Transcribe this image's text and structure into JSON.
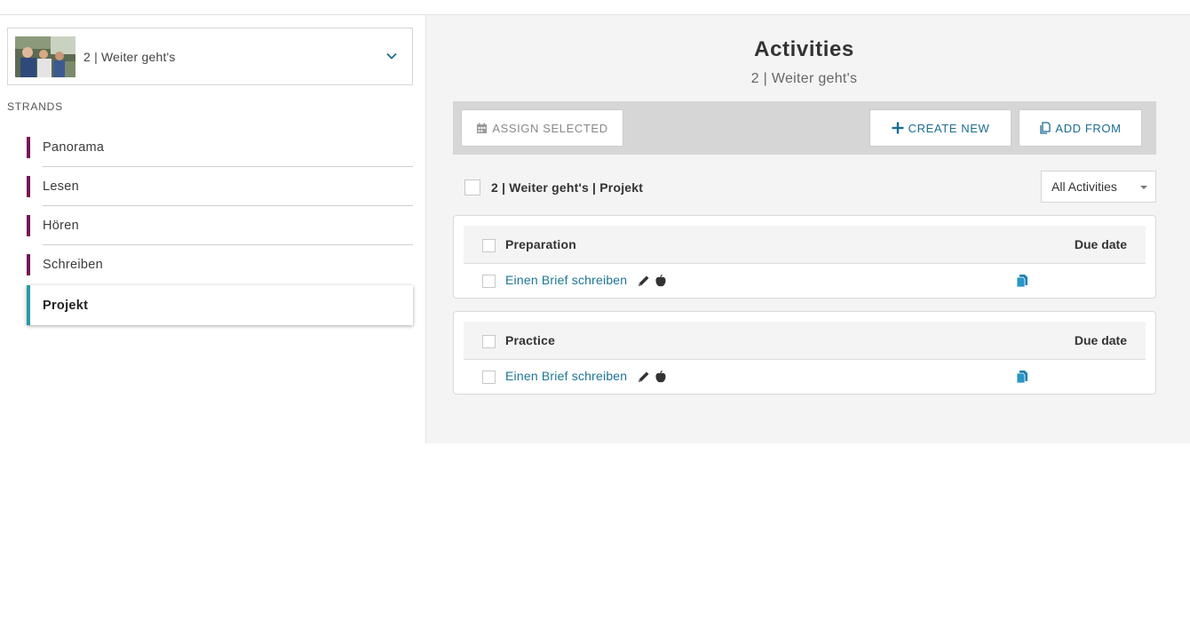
{
  "unit": {
    "title": "2 | Weiter geht's"
  },
  "sidebar": {
    "strands_label": "STRANDS",
    "items": [
      {
        "label": "Panorama"
      },
      {
        "label": "Lesen"
      },
      {
        "label": "Hören"
      },
      {
        "label": "Schreiben"
      },
      {
        "label": "Projekt",
        "active": true
      }
    ]
  },
  "main": {
    "title": "Activities",
    "subtitle": "2 | Weiter geht's",
    "toolbar": {
      "assign_label": "ASSIGN SELECTED",
      "create_label": "CREATE NEW",
      "add_from_label": "ADD FROM"
    },
    "group_label": "2 | Weiter geht's | Projekt",
    "filter": {
      "selected": "All Activities"
    },
    "sections": [
      {
        "name": "Preparation",
        "due_header": "Due date",
        "activities": [
          {
            "title": "Einen Brief schreiben"
          }
        ]
      },
      {
        "name": "Practice",
        "due_header": "Due date",
        "activities": [
          {
            "title": "Einen Brief schreiben"
          }
        ]
      }
    ]
  },
  "colors": {
    "strand_bar": "#7a1358",
    "active_strand_bar": "#2a9aa6",
    "link": "#1b7596",
    "toolbar_bg": "#d6d6d6",
    "main_bg": "#f4f4f4"
  },
  "icons": [
    "chevron-down-icon",
    "calendar-icon",
    "plus-icon",
    "copy-document-icon",
    "pencil-icon",
    "apple-icon",
    "assignment-doc-icon"
  ]
}
